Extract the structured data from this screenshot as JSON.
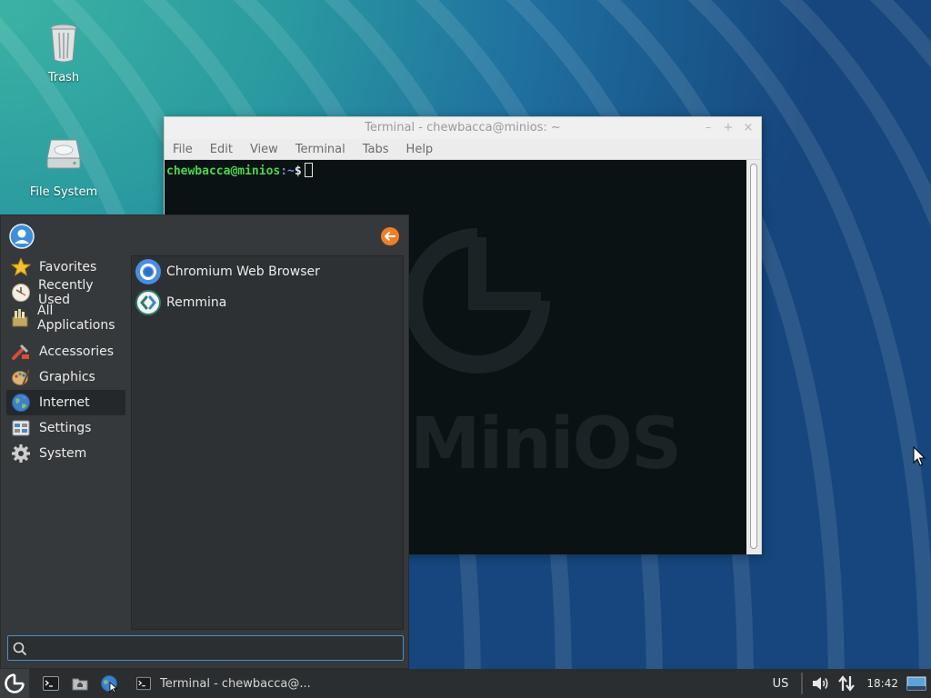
{
  "desktop": {
    "icons": [
      {
        "label": "Trash",
        "icon": "trash-icon"
      },
      {
        "label": "File System",
        "icon": "drive-icon"
      }
    ]
  },
  "terminal": {
    "title": "Terminal - chewbacca@minios: ~",
    "menu": [
      "File",
      "Edit",
      "View",
      "Terminal",
      "Tabs",
      "Help"
    ],
    "prompt_user": "chewbacca@minios",
    "prompt_path": ":~",
    "prompt_symbol": "$",
    "watermark": "MiniOS"
  },
  "app_menu": {
    "categories": [
      {
        "label": "Favorites",
        "icon": "star-icon"
      },
      {
        "label": "Recently Used",
        "icon": "clock-icon"
      },
      {
        "label": "All Applications",
        "icon": "applications-icon"
      },
      {
        "label": "Accessories",
        "icon": "accessories-icon"
      },
      {
        "label": "Graphics",
        "icon": "graphics-icon"
      },
      {
        "label": "Internet",
        "icon": "globe-icon",
        "selected": true
      },
      {
        "label": "Settings",
        "icon": "settings-icon"
      },
      {
        "label": "System",
        "icon": "gear-icon"
      }
    ],
    "apps": [
      {
        "label": "Chromium Web Browser",
        "icon": "chromium-icon"
      },
      {
        "label": "Remmina",
        "icon": "remmina-icon"
      }
    ],
    "search": {
      "value": "",
      "placeholder": ""
    }
  },
  "taskbar": {
    "task_label": "Terminal - chewbacca@...",
    "keyboard_layout": "US",
    "clock": "18:42"
  },
  "colors": {
    "menu_bg": "#36393b",
    "selected_bg": "#25282a",
    "terminal_bg": "#0b1214",
    "prompt_green": "#4fd44f",
    "accent_orange": "#f07e24",
    "search_border": "#4a8fc6"
  }
}
